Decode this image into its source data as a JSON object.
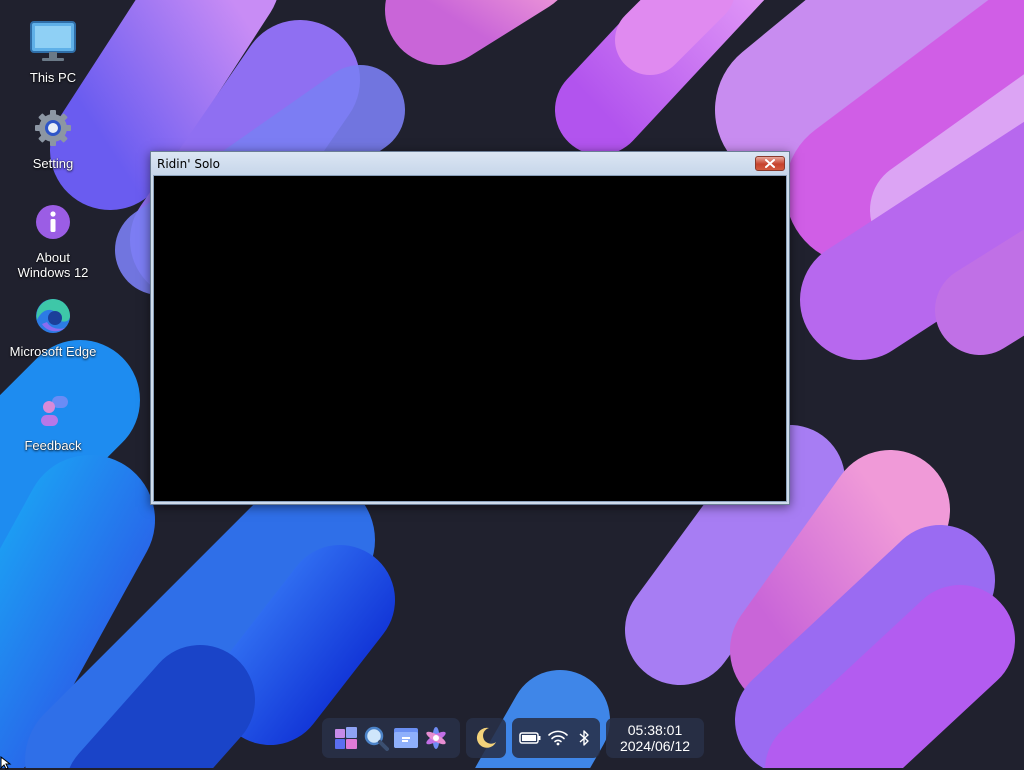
{
  "desktop": {
    "icons": [
      {
        "label": "This PC",
        "icon": "monitor-icon"
      },
      {
        "label": "Setting",
        "icon": "gear-icon"
      },
      {
        "label": "About Windows 12",
        "icon": "info-icon"
      },
      {
        "label": "Microsoft Edge",
        "icon": "edge-icon"
      },
      {
        "label": "Feedback",
        "icon": "feedback-icon"
      }
    ]
  },
  "window": {
    "title": "Ridin' Solo",
    "close_icon": "close-icon"
  },
  "taskbar": {
    "apps": [
      "start-icon",
      "search-icon",
      "file-explorer-icon",
      "copilot-icon"
    ],
    "night_light_icon": "moon-icon",
    "tray": [
      "battery-icon",
      "wifi-icon",
      "bluetooth-icon"
    ],
    "clock": {
      "time": "05:38:01",
      "date": "2024/06/12"
    }
  },
  "colors": {
    "accent_purple": "#b46cf0",
    "accent_blue": "#1e8cf0",
    "window_titlebar": "#cfdcec",
    "close_red": "#c6422c"
  }
}
